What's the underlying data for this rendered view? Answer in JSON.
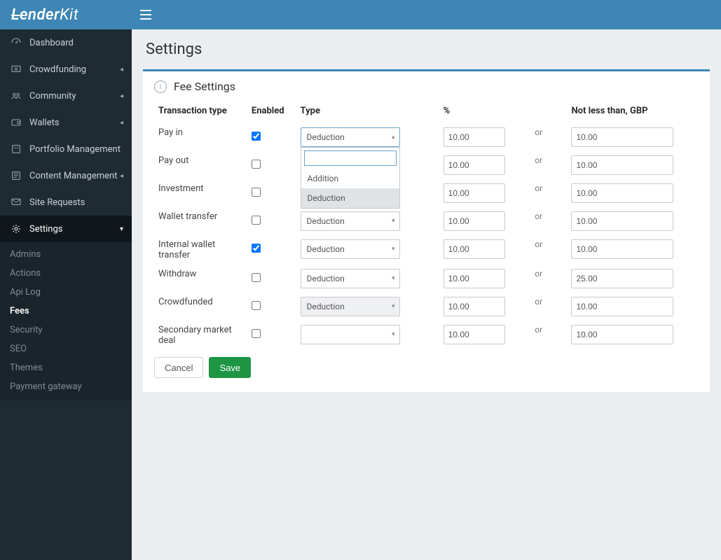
{
  "brand": "LenderKit",
  "page_title": "Settings",
  "panel_title": "Fee Settings",
  "nav": [
    {
      "icon": "dashboard",
      "label": "Dashboard",
      "expandable": false
    },
    {
      "icon": "crowdfunding",
      "label": "Crowdfunding",
      "expandable": true
    },
    {
      "icon": "community",
      "label": "Community",
      "expandable": true
    },
    {
      "icon": "wallets",
      "label": "Wallets",
      "expandable": true
    },
    {
      "icon": "portfolio",
      "label": "Portfolio Management",
      "expandable": false
    },
    {
      "icon": "content",
      "label": "Content Management",
      "expandable": true
    },
    {
      "icon": "site-requests",
      "label": "Site Requests",
      "expandable": false
    },
    {
      "icon": "settings",
      "label": "Settings",
      "expandable": true,
      "active": true
    }
  ],
  "subnav": [
    {
      "label": "Admins"
    },
    {
      "label": "Actions"
    },
    {
      "label": "Api Log"
    },
    {
      "label": "Fees",
      "active": true
    },
    {
      "label": "Security"
    },
    {
      "label": "SEO"
    },
    {
      "label": "Themes"
    },
    {
      "label": "Payment gateway"
    }
  ],
  "columns": {
    "tt": "Transaction type",
    "en": "Enabled",
    "type": "Type",
    "pct": "%",
    "gbp": "Not less than, GBP"
  },
  "type_options": [
    "Addition",
    "Deduction"
  ],
  "rows": [
    {
      "tt": "Pay in",
      "enabled": true,
      "type": "Deduction",
      "open": true,
      "pct": "10.00",
      "gbp": "10.00"
    },
    {
      "tt": "Pay out",
      "enabled": false,
      "type": "",
      "pct": "10.00",
      "gbp": "10.00"
    },
    {
      "tt": "Investment",
      "enabled": false,
      "type": "",
      "pct": "10.00",
      "gbp": "10.00"
    },
    {
      "tt": "Wallet transfer",
      "enabled": false,
      "type": "Deduction",
      "pct": "10.00",
      "gbp": "10.00"
    },
    {
      "tt": "Internal wallet transfer",
      "enabled": true,
      "type": "Deduction",
      "pct": "10.00",
      "gbp": "10.00"
    },
    {
      "tt": "Withdraw",
      "enabled": false,
      "type": "Deduction",
      "pct": "10.00",
      "gbp": "25.00"
    },
    {
      "tt": "Crowdfunded",
      "enabled": false,
      "type": "Deduction",
      "disabled": true,
      "pct": "10.00",
      "gbp": "10.00"
    },
    {
      "tt": "Secondary market deal",
      "enabled": false,
      "type": "",
      "pct": "10.00",
      "gbp": "10.00"
    }
  ],
  "or_label": "or",
  "pct_symbol": "%",
  "gbp_symbol": "£",
  "buttons": {
    "cancel": "Cancel",
    "save": "Save"
  }
}
